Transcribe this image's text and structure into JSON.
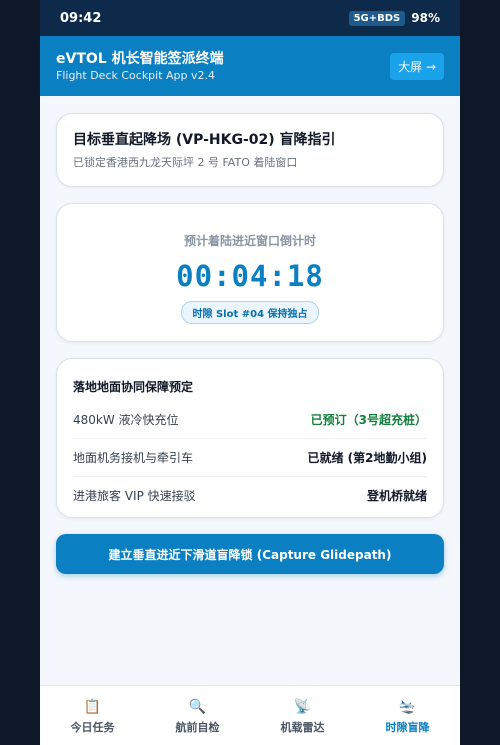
{
  "status_bar": {
    "time": "09:42",
    "network": "5G+BDS",
    "battery": "98%"
  },
  "app_bar": {
    "title": "eVTOL 机长智能签派终端",
    "subtitle": "Flight Deck Cockpit App v2.4",
    "big_screen_button": "大屏 →"
  },
  "target": {
    "title": "目标垂直起降场 (VP-HKG-02) 盲降指引",
    "subtitle": "已锁定香港西九龙天际坪 2 号 FATO 着陆窗口"
  },
  "countdown": {
    "label": "预计着陆进近窗口倒计时",
    "timer": "00:04:18",
    "slot_badge": "时隙 Slot #04 保持独占"
  },
  "booking": {
    "title": "落地地面协同保障预定",
    "rows": [
      {
        "label": "480kW 液冷快充位",
        "value": "已预订（3号超充桩）",
        "color": "#15803d"
      },
      {
        "label": "地面机务接机与牵引车",
        "value": "已就绪 (第2地勤小组)"
      },
      {
        "label": "进港旅客 VIP 快速接驳",
        "value": "登机桥就绪"
      }
    ]
  },
  "capture_button": "建立垂直进近下滑道盲降锁 (Capture Glidepath)",
  "tabs": [
    {
      "label": "今日任务",
      "icon": "clipboard-icon",
      "glyph": "📋"
    },
    {
      "label": "航前自检",
      "icon": "magnifier-icon",
      "glyph": "🔍"
    },
    {
      "label": "机载雷达",
      "icon": "radar-icon",
      "glyph": "📡"
    },
    {
      "label": "时隙盲降",
      "icon": "landing-plane-icon",
      "glyph": "🛬",
      "active": true
    }
  ],
  "colors": {
    "primary": "#0a7fc2",
    "status_bar": "#0d2a4a",
    "success": "#15803d"
  }
}
